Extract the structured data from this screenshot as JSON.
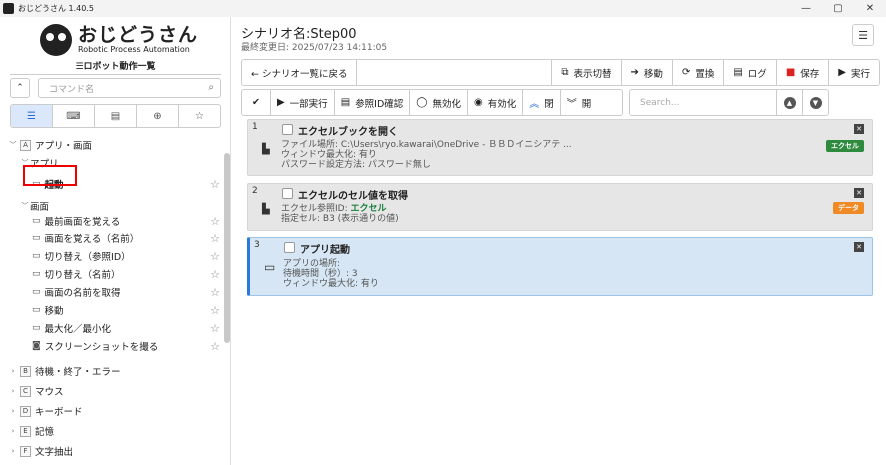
{
  "window": {
    "title": "おじどうさん 1.40.5",
    "minimize": "—",
    "maximize": "▢",
    "close": "✕"
  },
  "sidebar": {
    "logo_title": "おじどうさん",
    "logo_subtitle": "Robotic Process Automation",
    "section_title": "☰ロボット動作一覧",
    "collapse_icon": "⌃",
    "search_placeholder": "コマンド名",
    "tabs": [
      "☰",
      "⌨",
      "▤",
      "⊕",
      "☆"
    ],
    "tree": [
      {
        "label": "アプリ・画面",
        "badge": "A",
        "level": 0,
        "chev": "﹀"
      },
      {
        "label": "アプリ",
        "level": 1,
        "chev": "﹀"
      },
      {
        "label": "起動",
        "level": 2,
        "bold": true
      },
      {
        "label": "画面",
        "level": 1,
        "chev": "﹀"
      },
      {
        "label": "最前画面を覚える",
        "level": 2
      },
      {
        "label": "画面を覚える（名前）",
        "level": 2
      },
      {
        "label": "切り替え（参照ID）",
        "level": 2
      },
      {
        "label": "切り替え（名前）",
        "level": 2
      },
      {
        "label": "画面の名前を取得",
        "level": 2
      },
      {
        "label": "移動",
        "level": 2
      },
      {
        "label": "最大化／最小化",
        "level": 2
      },
      {
        "label": "スクリーンショットを撮る",
        "level": 2
      },
      {
        "label": "待機・終了・エラー",
        "badge": "B",
        "level": 0,
        "chev": "›"
      },
      {
        "label": "マウス",
        "badge": "C",
        "level": 0,
        "chev": "›"
      },
      {
        "label": "キーボード",
        "badge": "D",
        "level": 0,
        "chev": "›"
      },
      {
        "label": "記憶",
        "badge": "E",
        "level": 0,
        "chev": "›"
      },
      {
        "label": "文字抽出",
        "badge": "F",
        "level": 0,
        "chev": "›"
      }
    ]
  },
  "main": {
    "scenario_title": "シナリオ名:Step00",
    "last_modified": "最終変更日: 2025/07/23 14:11:05",
    "menu_icon": "☰",
    "toolbar1": {
      "back": "← シナリオ一覧に戻る",
      "display_switch": "表示切替",
      "move": "移動",
      "replace": "置換",
      "log": "ログ",
      "save": "保存",
      "run": "実行"
    },
    "toolbar2": {
      "check": "✔",
      "partial_run": "一部実行",
      "ref_id_check": "参照ID確認",
      "disable": "無効化",
      "enable": "有効化",
      "close": "閉",
      "open": "開",
      "search_placeholder": "Search..."
    },
    "steps": [
      {
        "num": "1",
        "title": "エクセルブックを開く",
        "lines": [
          "ファイル場所: C:\\Users\\ryo.kawarai\\OneDrive - ＢＢＤイニシアテ ...",
          "ウィンドウ最大化: 有り",
          "パスワード設定方法: パスワード無し"
        ],
        "tag": "エクセル",
        "tag_color": "#2e8b3e"
      },
      {
        "num": "2",
        "title": "エクセルのセル値を取得",
        "line1_prefix": "エクセル参照ID: ",
        "line1_value": "エクセル",
        "line2": "指定セル: B3 (表示通りの値)",
        "tag": "データ",
        "tag_color": "#f08a24"
      },
      {
        "num": "3",
        "title": "アプリ起動",
        "lines": [
          "アプリの場所:",
          "待機時間（秒）: 3",
          "ウィンドウ最大化: 有り"
        ]
      }
    ]
  }
}
